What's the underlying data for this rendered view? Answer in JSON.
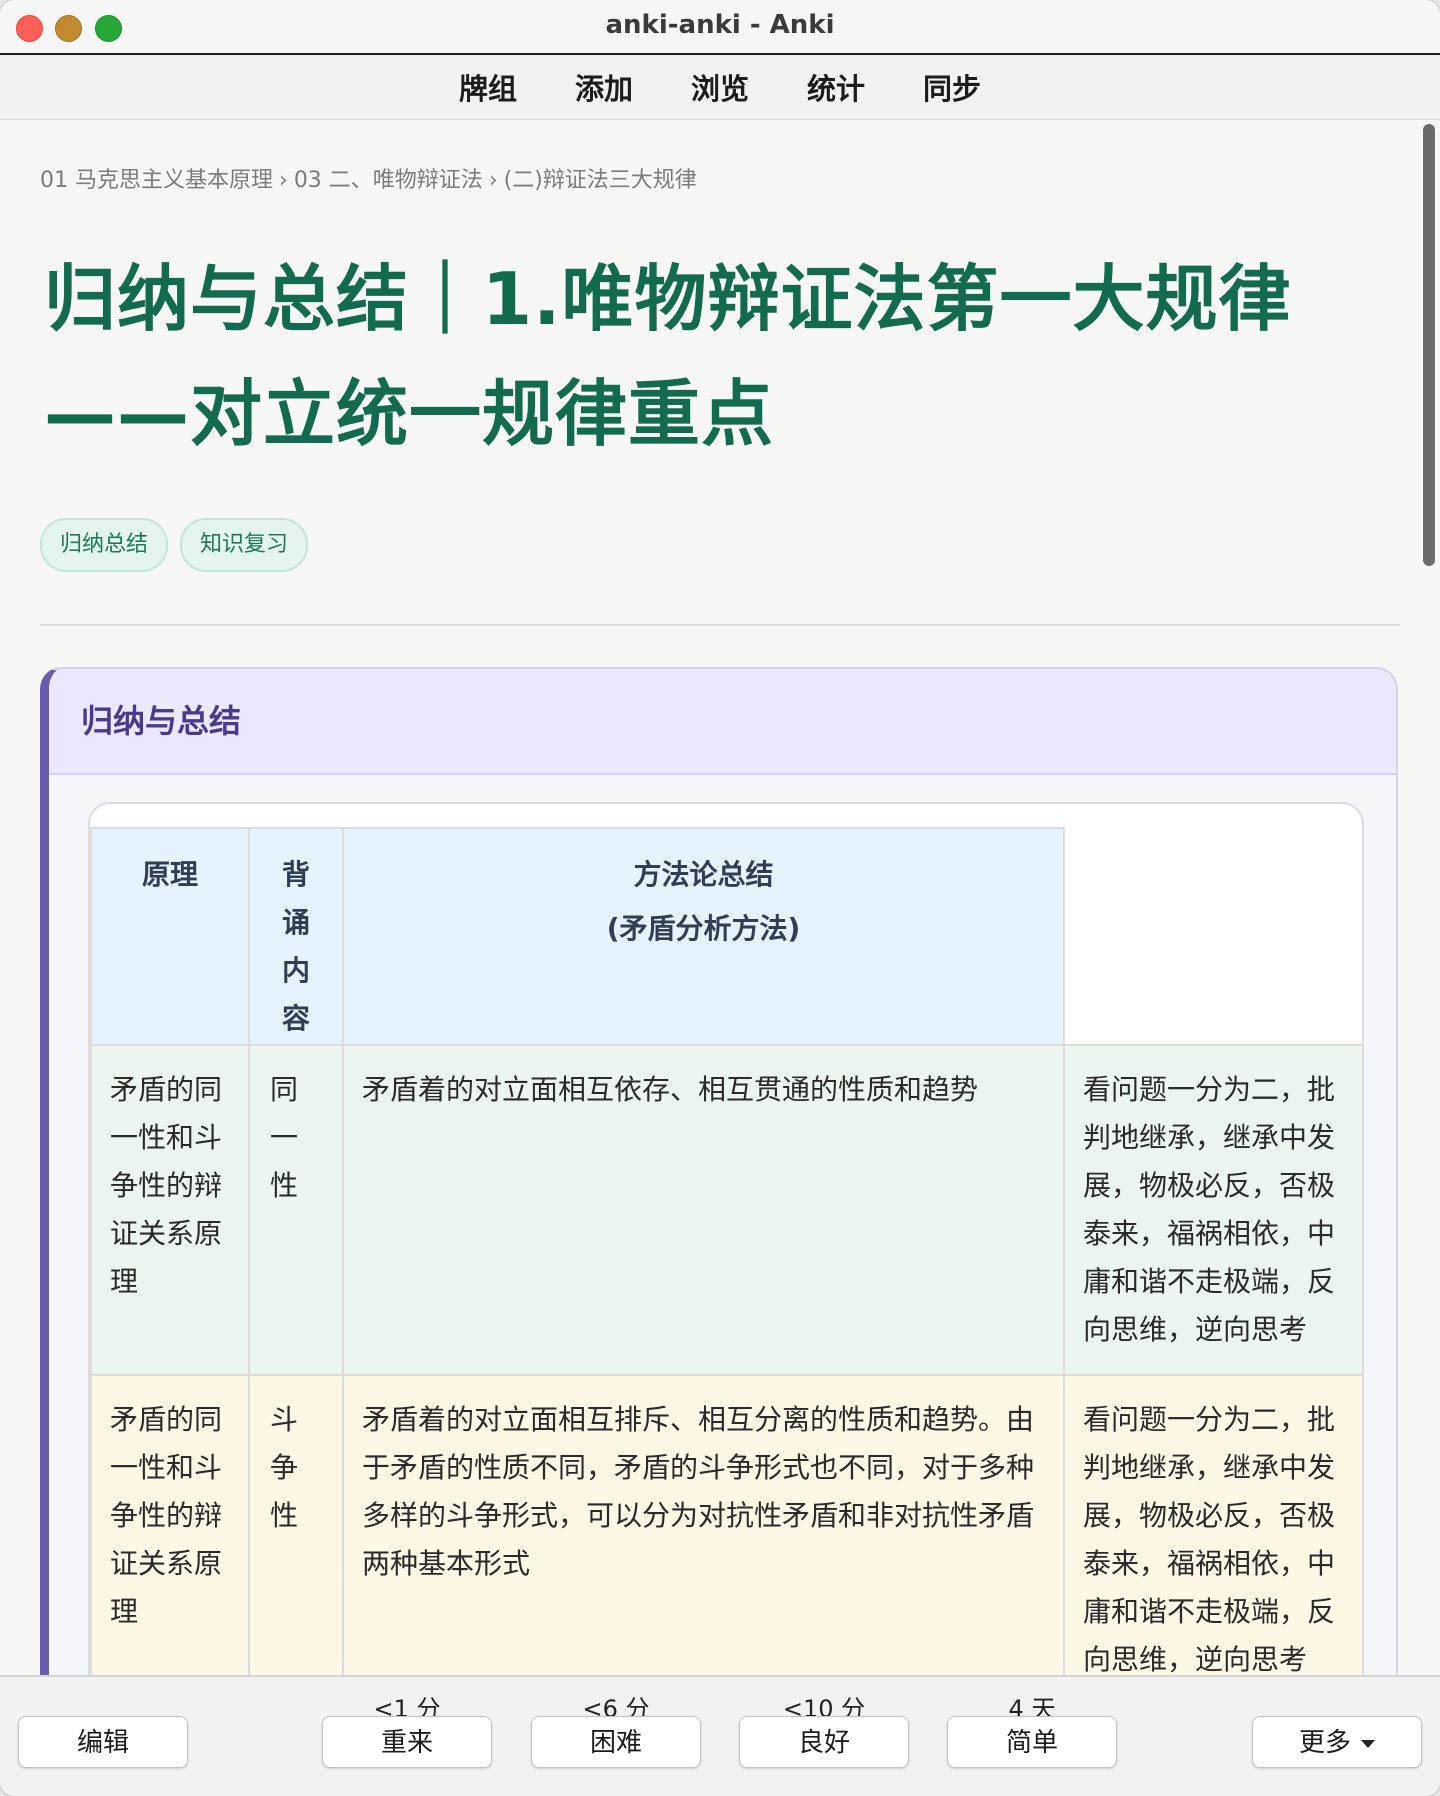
{
  "window": {
    "title": "anki-anki - Anki"
  },
  "toolbar": {
    "items": [
      "牌组",
      "添加",
      "浏览",
      "统计",
      "同步"
    ]
  },
  "breadcrumb": [
    "01 马克思主义基本原理",
    "03 二、唯物辩证法",
    "(二)辩证法三大规律"
  ],
  "breadcrumb_sep": "›",
  "page": {
    "title_line1": "归纳与总结｜1.唯物辩证法第一大规律",
    "title_line2": "——对立统一规律重点",
    "tags": [
      "归纳总结",
      "知识复习"
    ]
  },
  "callout": {
    "heading": "归纳与总结",
    "table": {
      "headers": {
        "col1": "原理",
        "col2": "背诵内容",
        "col3_line1": "方法论总结",
        "col3_line2": "(矛盾分析方法)"
      },
      "rows": [
        {
          "principle": "矛盾的同一性和斗争性的辩证关系原理",
          "recite": "同一性",
          "content": "矛盾着的对立面相互依存、相互贯通的性质和趋势",
          "method": "看问题一分为二，批判地继承，继承中发展，物极必反，否极泰来，福祸相依，中庸和谐不走极端，反向思维，逆向思考"
        },
        {
          "principle": "矛盾的同一性和斗争性的辩证关系原理",
          "recite": "斗争性",
          "content": "矛盾着的对立面相互排斥、相互分离的性质和趋势。由于矛盾的性质不同，矛盾的斗争形式也不同，对于多种多样的斗争形式，可以分为对抗性矛盾和非对抗性矛盾两种基本形式",
          "method": "看问题一分为二，批判地继承，继承中发展，物极必反，否极泰来，福祸相依，中庸和谐不走极端，反向思维，逆向思考"
        }
      ]
    }
  },
  "answer_bar": {
    "edit": "编辑",
    "more": "更多",
    "buttons": [
      {
        "label": "重来",
        "interval": "<1 分"
      },
      {
        "label": "困难",
        "interval": "<6 分"
      },
      {
        "label": "良好",
        "interval": "<10 分"
      },
      {
        "label": "简单",
        "interval": "4 天"
      }
    ]
  },
  "colors": {
    "title_green": "#126b4f",
    "callout_accent": "#6b5bb0",
    "header_blue": "#e4f3fd",
    "row_green": "#ecf6ef",
    "row_yellow": "#fdf7e6"
  }
}
